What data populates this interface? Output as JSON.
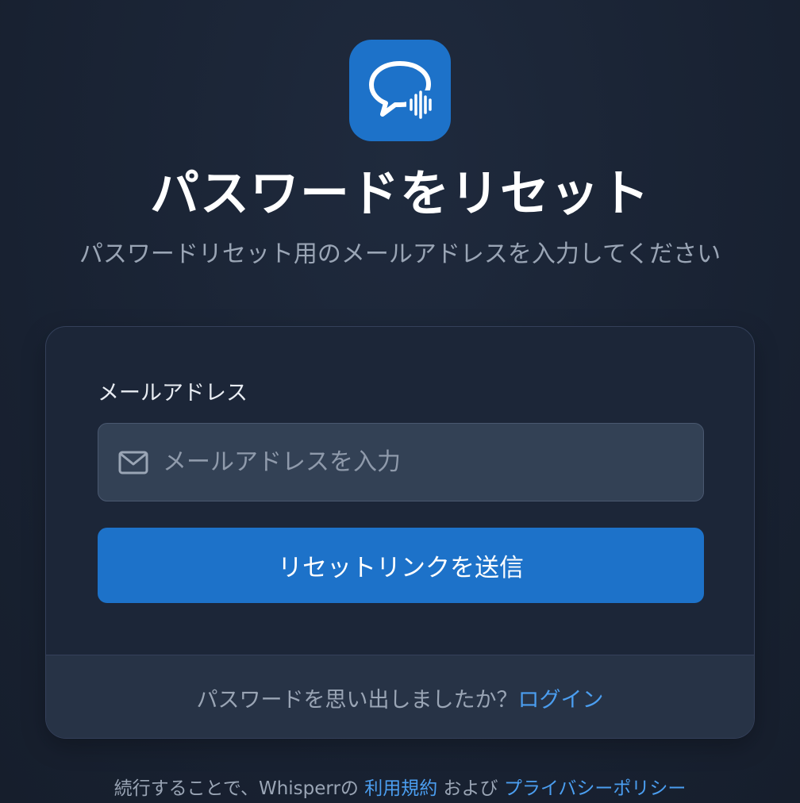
{
  "app": {
    "logo_icon": "chat-bubble-soundwave-icon",
    "accent_color": "#1d72c9",
    "link_color": "#4b9ef0"
  },
  "header": {
    "title": "パスワードをリセット",
    "subtitle": "パスワードリセット用のメールアドレスを入力してください"
  },
  "form": {
    "email_label": "メールアドレス",
    "email_icon": "mail-icon",
    "email_placeholder": "メールアドレスを入力",
    "email_value": "",
    "submit_label": "リセットリンクを送信"
  },
  "footer": {
    "prompt": "パスワードを思い出しましたか？",
    "login_link": "ログイン"
  },
  "legal": {
    "prefix": "続行することで、Whisperrの",
    "terms_link": "利用規約",
    "and": "および",
    "privacy_link": "プライバシーポリシー"
  }
}
